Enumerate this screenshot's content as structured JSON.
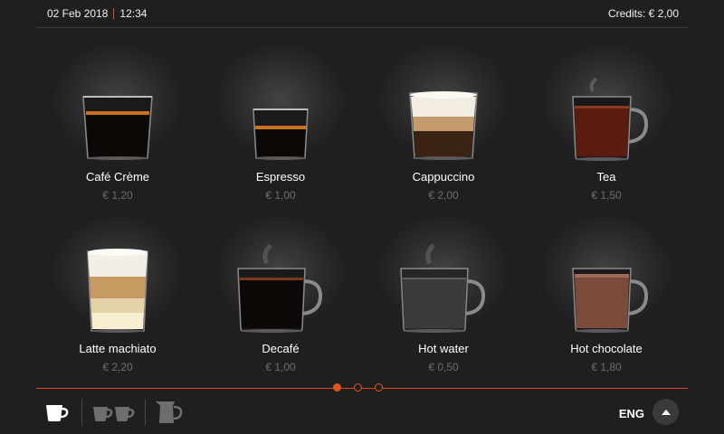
{
  "header": {
    "date": "02 Feb 2018",
    "time": "12:34",
    "credits": "Credits: € 2,00"
  },
  "drinks": [
    {
      "name": "Café Crème",
      "price": "€ 1,20"
    },
    {
      "name": "Espresso",
      "price": "€ 1,00"
    },
    {
      "name": "Cappuccino",
      "price": "€ 2,00"
    },
    {
      "name": "Tea",
      "price": "€ 1,50"
    },
    {
      "name": "Latte machiato",
      "price": "€ 2,20"
    },
    {
      "name": "Decafé",
      "price": "€ 1,00"
    },
    {
      "name": "Hot water",
      "price": "€ 0,50"
    },
    {
      "name": "Hot chocolate",
      "price": "€ 1,80"
    }
  ],
  "pager": {
    "current_page": 1,
    "total_pages": 3
  },
  "footer": {
    "language": "ENG",
    "icons": [
      "single-cup-icon",
      "double-cup-icon",
      "jug-icon",
      "chevron-up-icon"
    ]
  },
  "colors": {
    "accent": "#e2531e",
    "background": "#1f1f1f",
    "price_text": "#6d6d6d"
  }
}
